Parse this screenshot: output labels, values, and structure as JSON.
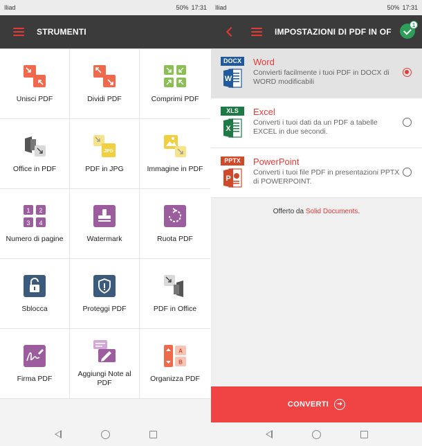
{
  "status_bar": {
    "carrier": "Iliad",
    "battery": "50%",
    "time": "17:31"
  },
  "left_screen": {
    "title": "STRUMENTI",
    "tools": [
      {
        "label": "Unisci PDF",
        "icon": "merge-icon"
      },
      {
        "label": "Dividi PDF",
        "icon": "split-icon"
      },
      {
        "label": "Comprimi PDF",
        "icon": "compress-icon"
      },
      {
        "label": "Office in PDF",
        "icon": "office-to-pdf-icon"
      },
      {
        "label": "PDF in JPG",
        "icon": "jpg-icon"
      },
      {
        "label": "Immagine in PDF",
        "icon": "image-to-pdf-icon"
      },
      {
        "label": "Numero di pagine",
        "icon": "page-numbers-icon"
      },
      {
        "label": "Watermark",
        "icon": "watermark-icon"
      },
      {
        "label": "Ruota PDF",
        "icon": "rotate-icon"
      },
      {
        "label": "Sblocca",
        "icon": "unlock-icon"
      },
      {
        "label": "Proteggi PDF",
        "icon": "protect-icon"
      },
      {
        "label": "PDF in Office",
        "icon": "pdf-to-office-icon"
      },
      {
        "label": "Firma PDF",
        "icon": "sign-icon"
      },
      {
        "label": "Aggiungi Note al PDF",
        "icon": "add-notes-icon"
      },
      {
        "label": "Organizza PDF",
        "icon": "organize-icon"
      }
    ]
  },
  "right_screen": {
    "title": "IMPOSTAZIONI DI PDF IN OF",
    "badge_count": "1",
    "options": [
      {
        "tag": "DOCX",
        "tag_color": "#1f5a9e",
        "doc_letter": "W",
        "title": "Word",
        "desc": "Convierti facilmente i tuoi PDF in DOCX di WORD modificabili",
        "selected": true
      },
      {
        "tag": "XLS",
        "tag_color": "#1e7a45",
        "doc_letter": "X",
        "title": "Excel",
        "desc": "Converti i tuoi dati da un PDF a tabelle EXCEL in due secondi.",
        "selected": false
      },
      {
        "tag": "PPTX",
        "tag_color": "#d04a2a",
        "doc_letter": "P",
        "title": "PowerPoint",
        "desc": "Converti i tuoi file PDF in presentazioni PPTX di POWERPOINT.",
        "selected": false
      }
    ],
    "offered_by_prefix": "Offerto da ",
    "offered_by_brand": "Solid Documents",
    "offered_by_suffix": ".",
    "convert_label": "CONVERTI"
  },
  "colors": {
    "accent_red": "#e53935",
    "appbar": "#3b3b3b",
    "tile_orange": "#ef6a4c",
    "tile_green": "#8bbf55",
    "tile_yellow": "#f2cf3f",
    "tile_purple": "#9c5d9f",
    "tile_navy": "#3c5a7c",
    "convert_button": "#f04444"
  }
}
